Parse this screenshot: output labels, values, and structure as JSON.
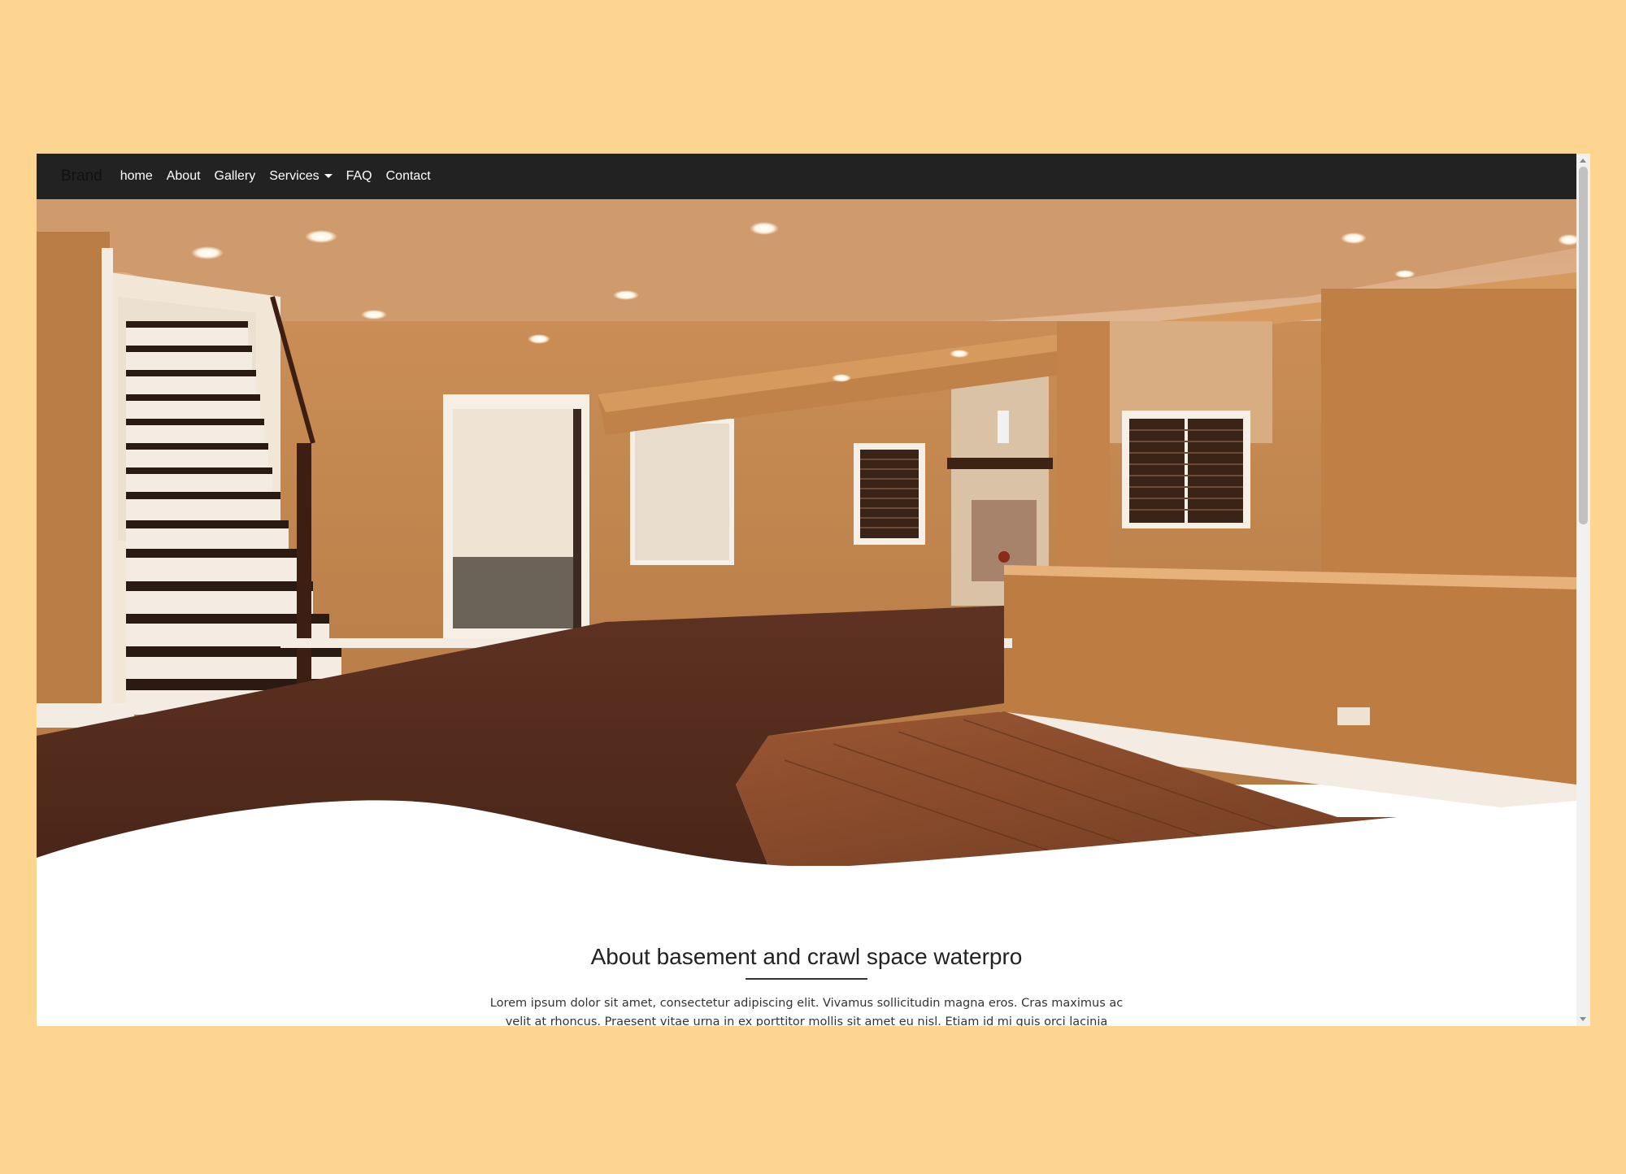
{
  "navbar": {
    "brand": "Brand",
    "links": [
      {
        "label": "home"
      },
      {
        "label": "About"
      },
      {
        "label": "Gallery"
      },
      {
        "label": "Services"
      },
      {
        "label": "FAQ"
      },
      {
        "label": "Contact"
      }
    ]
  },
  "hero": {
    "image": "basement-interior-photo"
  },
  "about": {
    "title": "About basement and crawl space waterpro",
    "text": "Lorem ipsum dolor sit amet, consectetur adipiscing elit. Vivamus sollicitudin magna eros. Cras maximus ac velit at rhoncus. Praesent vitae urna in ex porttitor mollis sit amet eu nisl. Etiam id mi quis orci lacinia bibendum sit"
  },
  "colors": {
    "backdrop": "#fed491",
    "navbar": "#222222",
    "wall": "#c8894f",
    "carpet": "#5a2f1e",
    "wood": "#8a4a2a"
  }
}
